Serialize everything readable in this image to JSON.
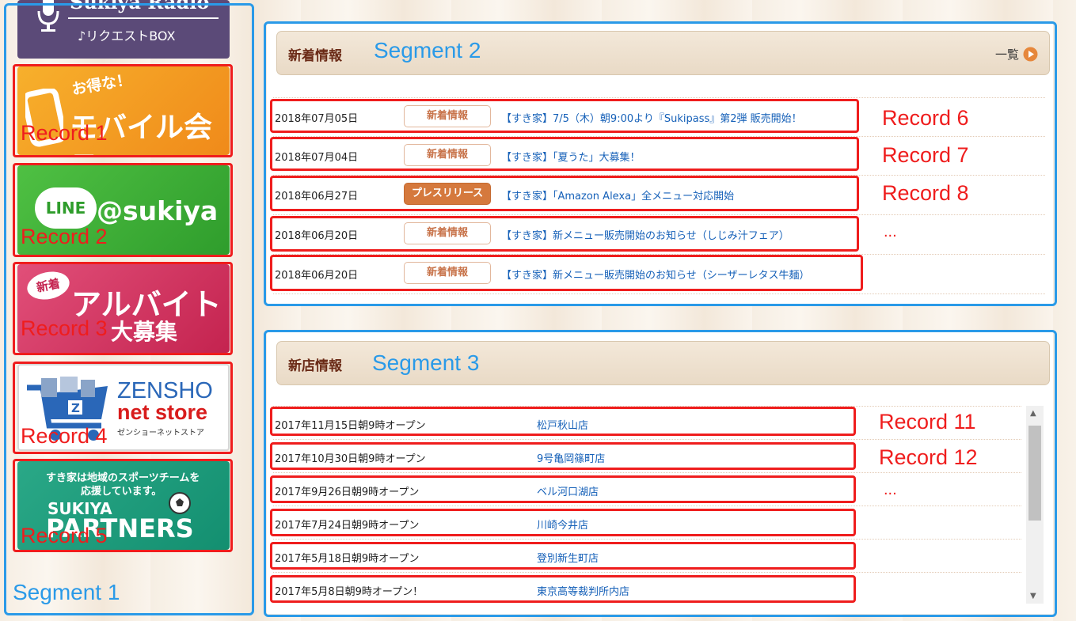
{
  "colors": {
    "segment": "#2a9ae8",
    "record": "#ef1d1d",
    "head": "#6a2a16",
    "link": "#1560b8",
    "press": "#d5793d"
  },
  "sidebar": {
    "radio": {
      "title": "Sukiya Radio",
      "sub": "♪リクエストBOX",
      "icon": "microphone-icon"
    },
    "mobile": {
      "tag": "お得な！",
      "title": "モバイル会員",
      "icon": "smartphone-icon"
    },
    "line": {
      "logo": "LINE",
      "handle": "@sukiya"
    },
    "baito": {
      "tag": "新着",
      "title": "アルバイト",
      "sub": "大募集"
    },
    "zensho": {
      "brand": "ZENSHO",
      "store": "net store",
      "kana": "ゼンショーネットストア",
      "icon": "shopping-cart-icon"
    },
    "partners": {
      "line1": "すき家は地域のスポーツチームを",
      "line2": "応援しています。",
      "brand": "SUKIYA",
      "title": "PARTNERS",
      "icon": "soccer-ball-icon"
    }
  },
  "annotations": {
    "segments": [
      "Segment 1",
      "Segment 2",
      "Segment 3"
    ],
    "records": [
      "Record 1",
      "Record 2",
      "Record 3",
      "Record 4",
      "Record 5",
      "Record 6",
      "Record 7",
      "Record 8",
      "...",
      "Record 11",
      "Record 12",
      "..."
    ]
  },
  "news": {
    "title": "新着情報",
    "list_link": "一覧",
    "rows": [
      {
        "date": "2018年07月05日",
        "badge": "新着情報",
        "title": "【すき家】7/5（木）朝9:00より『Sukipass』第2弾 販売開始！"
      },
      {
        "date": "2018年07月04日",
        "badge": "新着情報",
        "title": "【すき家】「夏うた」大募集！"
      },
      {
        "date": "2018年06月27日",
        "badge": "プレスリリース",
        "title": "【すき家】「Amazon Alexa」全メニュー対応開始"
      },
      {
        "date": "2018年06月20日",
        "badge": "新着情報",
        "title": "【すき家】新メニュー販売開始のお知らせ（しじみ汁フェア）"
      },
      {
        "date": "2018年06月20日",
        "badge": "新着情報",
        "title": "【すき家】新メニュー販売開始のお知らせ（シーザーレタス牛麺）"
      }
    ]
  },
  "stores": {
    "title": "新店情報",
    "rows": [
      {
        "date": "2017年11月15日朝9時オープン",
        "store": "松戸秋山店"
      },
      {
        "date": "2017年10月30日朝9時オープン",
        "store": "9号亀岡篠町店"
      },
      {
        "date": "2017年9月26日朝9時オープン",
        "store": "ベル河口湖店"
      },
      {
        "date": "2017年7月24日朝9時オープン",
        "store": "川崎今井店"
      },
      {
        "date": "2017年5月18日朝9時オープン",
        "store": "登別新生町店"
      },
      {
        "date": "2017年5月8日朝9時オープン！",
        "store": "東京高等裁判所内店"
      }
    ]
  }
}
